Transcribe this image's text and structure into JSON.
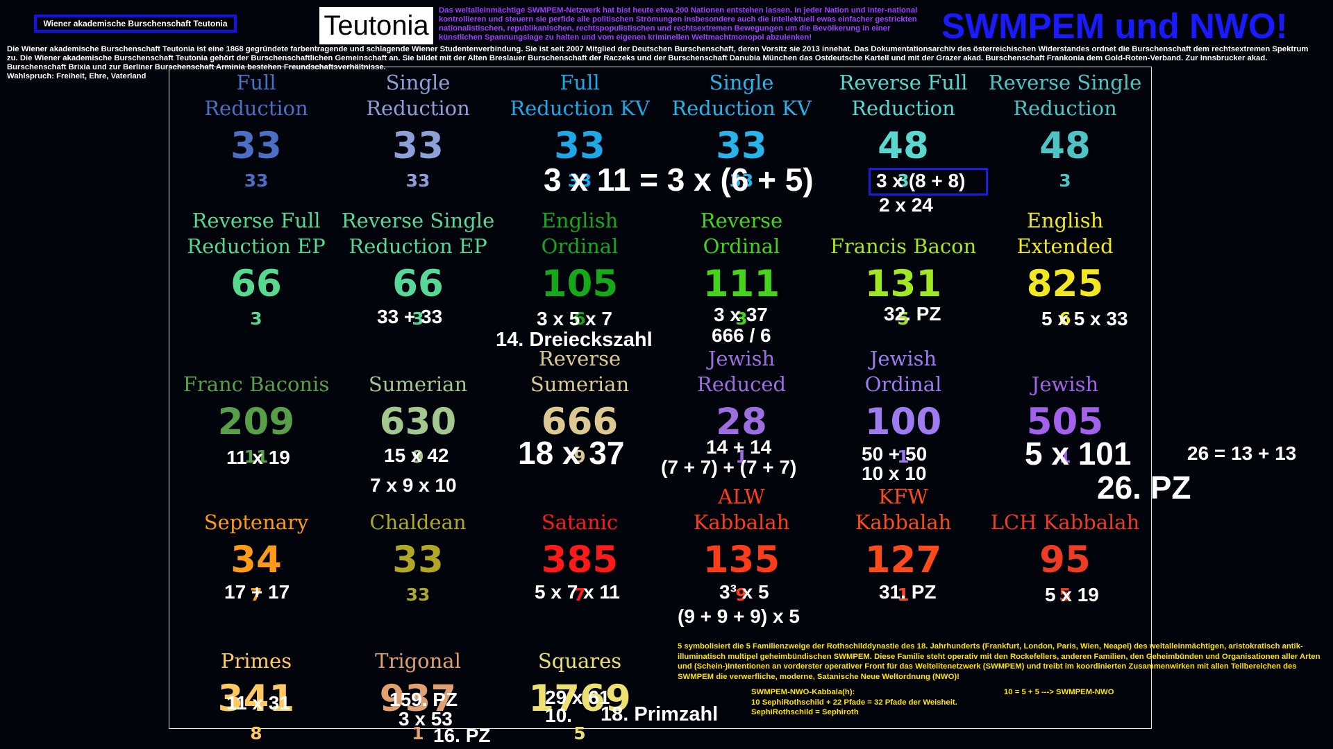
{
  "header": {
    "badge": "Wiener akademische Burschenschaft Teutonia",
    "intro": "Die Wiener akademische Burschenschaft Teutonia ist eine 1868 gegründete farbentragende und schlagende Wiener Studentenverbindung. Sie ist seit 2007 Mitglied der Deutschen Burschenschaft, deren Vorsitz sie 2013 innehat. Das Dokumentationsarchiv des österreichischen Widerstandes ordnet die Burschenschaft dem rechtsextremen Spektrum zu.    Die Wiener akademische Burschenschaft Teutonia gehört der Burschenschaftlichen Gemeinschaft an. Sie bildet mit der Alten Breslauer Burschenschaft der Raczeks und der Burschenschaft Danubia München das Ostdeutsche Kartell und mit der Grazer akad. Burschenschaft Frankonia dem Gold-Roten-Verband. Zur Innsbrucker akad. Burschenschaft Brixia und zur Berliner Burschenschaft Arminia bestehen Freundschaftsverhältnisse.",
    "motto": "Wahlspruch: Freiheit, Ehre, Vaterland",
    "logo": "Teutonia",
    "logo_note": "Das weltalleinmächtige SWMPEM-Netzwerk hat bist heute etwa 200 Nationen entstehen lassen. In jeder Nation und inter-national kontrollieren und steuern sie perfide alle politischen Strömungen insbesondere auch die intellektuell ewas einfacher gestrickten nationalistischen, republikanischen, rechtspopulistischen und rechtsextremen Bewegungen um die Bevölkerung in einer künstlichen Spannungslage zu halten und vom eigenen kriminellen Weltmachtmonopol abzulenken!",
    "title": "SWMPEM und NWO!"
  },
  "ciphers": [
    {
      "label": "Full\nReduction",
      "value": "33",
      "sub": "33",
      "color": "#4a6fc4"
    },
    {
      "label": "Single\nReduction",
      "value": "33",
      "sub": "33",
      "color": "#8ea0d8"
    },
    {
      "label": "Full\nReduction KV",
      "value": "33",
      "sub": "33",
      "color": "#1ea8e8"
    },
    {
      "label": "Single\nReduction KV",
      "value": "33",
      "sub": "33",
      "color": "#28b4ea"
    },
    {
      "label": "Reverse Full\nReduction",
      "value": "48",
      "sub": "3",
      "color": "#5ad8d0"
    },
    {
      "label": "Reverse Single\nReduction",
      "value": "48",
      "sub": "3",
      "color": "#4ec4c4"
    },
    {
      "label": "Reverse Full\nReduction EP",
      "value": "66",
      "sub": "3",
      "color": "#56d88e"
    },
    {
      "label": "Reverse Single\nReduction EP",
      "value": "66",
      "sub": "3",
      "color": "#58d898"
    },
    {
      "label": "English\nOrdinal",
      "value": "105",
      "sub": "6",
      "color": "#17a81a"
    },
    {
      "label": "Reverse\nOrdinal",
      "value": "111",
      "sub": "3",
      "color": "#44d41c"
    },
    {
      "label": "Francis Bacon",
      "value": "131",
      "sub": "5",
      "color": "#a0e824"
    },
    {
      "label": "English\nExtended",
      "value": "825",
      "sub": "6",
      "color": "#f2e820"
    },
    {
      "label": "Franc Baconis",
      "value": "209",
      "sub": "11",
      "color": "#58a048"
    },
    {
      "label": "Sumerian",
      "value": "630",
      "sub": "9",
      "color": "#a2c890"
    },
    {
      "label": "Reverse\nSumerian",
      "value": "666",
      "sub": "9",
      "color": "#dcc890"
    },
    {
      "label": "Jewish\nReduced",
      "value": "28",
      "sub": "1",
      "color": "#9e6ee0"
    },
    {
      "label": "Jewish\nOrdinal",
      "value": "100",
      "sub": "1",
      "color": "#9e7cf0"
    },
    {
      "label": "Jewish",
      "value": "505",
      "sub": "1",
      "color": "#a462ec"
    },
    {
      "label": "Septenary",
      "value": "34",
      "sub": "7",
      "color": "#ff9a18"
    },
    {
      "label": "Chaldean",
      "value": "33",
      "sub": "33",
      "color": "#b0a824"
    },
    {
      "label": "Satanic",
      "value": "385",
      "sub": "7",
      "color": "#ff1a1a"
    },
    {
      "label": "ALW\nKabbalah",
      "value": "135",
      "sub": "9",
      "color": "#ff3c1a"
    },
    {
      "label": "KFW\nKabbalah",
      "value": "127",
      "sub": "1",
      "color": "#ff4a1a"
    },
    {
      "label": "LCH Kabbalah",
      "value": "95",
      "sub": "5",
      "color": "#ee3c24"
    },
    {
      "label": "Primes",
      "value": "341",
      "sub": "8",
      "color": "#ffc860"
    },
    {
      "label": "Trigonal",
      "value": "937",
      "sub": "1",
      "color": "#e0a070"
    },
    {
      "label": "Squares",
      "value": "1769",
      "sub": "5",
      "color": "#eee070"
    }
  ],
  "notes": [
    "3 x 11 = 3 x (6 + 5)",
    "3 x (8 + 8)",
    "2 x 24",
    "33 + 33",
    "3 x 5 x 7",
    "14. Dreieckszahl",
    "3 x 37",
    "666 / 6",
    "32. PZ",
    "5 x 5 x 33",
    "11 x 19",
    "15 x 42",
    "7 x 9 x 10",
    "18 x 37",
    "14 + 14",
    "(7 + 7) + (7 + 7)",
    "50 + 50",
    "10 x 10",
    "5 x 101",
    "26. PZ",
    "26 = 13 + 13",
    "17 + 17",
    "5 x 7 x 11",
    "3³ x 5",
    "(9 + 9 + 9) x 5",
    "31. PZ",
    "5 x 19",
    "11 x 31",
    "159. PZ",
    "3 x 53",
    "16. PZ",
    "29 x 61",
    "10.",
    "18. Primzahl"
  ],
  "footer": {
    "family_note": "5 symbolisiert die 5 Familienzweige der Rothschilddynastie des 18. Jahrhunderts (Frankfurt, London, Paris, Wien, Neapel) des weltalleinmächtigen, aristokratisch antik-illuminatisch multipel geheimbündischen SWMPEM. Diese Familie steht operativ mit den Rockefellers, anderen Familien, den Geheimbünden und Organisationen aller Arten und (Schein-)Intentionen an vorderster operativer Front für das Weltelitenetzwerk (SWMPEM) und treibt im koordinierten Zusammenwirken mit allen Teilbereichen des SWMPEM die verwerfliche, moderne, Satanische Neue Weltordnung (NWO)!",
    "kabbalah_title": "SWMPEM-NWO-Kabbala(h):",
    "kabbalah_line1": "10 SephiRothschild + 22 Pfade = 32 Pfade der Weisheit.",
    "kabbalah_line2": "SephiRothschild = Sephiroth",
    "formula": "10 = 5 + 5 ---> SWMPEM-NWO"
  }
}
